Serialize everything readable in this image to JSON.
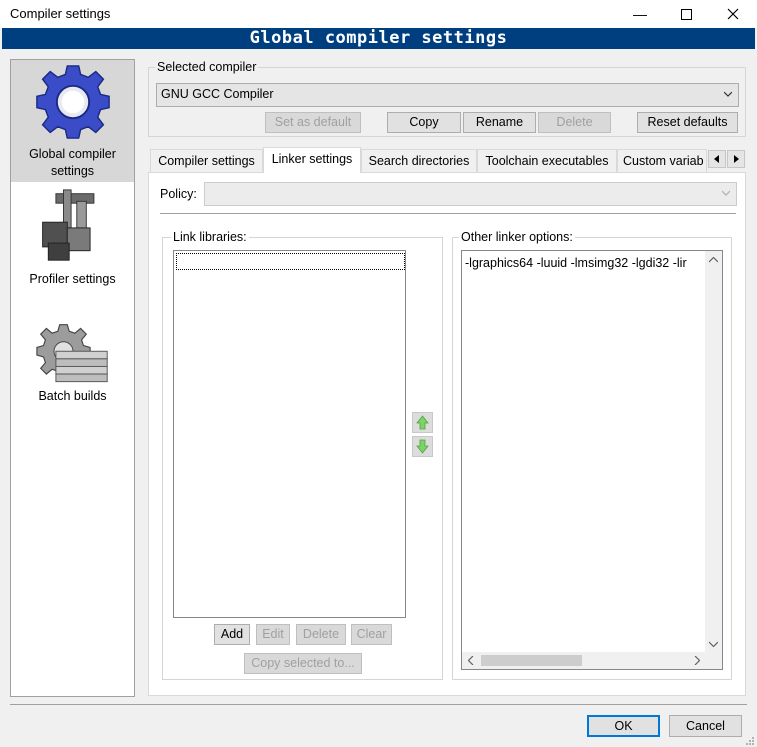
{
  "window": {
    "title": "Compiler settings",
    "banner": "Global compiler settings"
  },
  "sidebar": {
    "items": [
      {
        "label_line1": "Global compiler",
        "label_line2": "settings",
        "icon": "gear-icon",
        "selected": true
      },
      {
        "label": "Profiler settings",
        "icon": "profiler-icon",
        "selected": false
      },
      {
        "label": "Batch builds",
        "icon": "batch-builds-icon",
        "selected": false
      }
    ]
  },
  "compiler": {
    "group_label": "Selected compiler",
    "selected": "GNU GCC Compiler",
    "buttons": {
      "set_default": "Set as default",
      "copy": "Copy",
      "rename": "Rename",
      "delete": "Delete",
      "reset": "Reset defaults"
    }
  },
  "tabs": [
    {
      "label": "Compiler settings",
      "active": false
    },
    {
      "label": "Linker settings",
      "active": true
    },
    {
      "label": "Search directories",
      "active": false
    },
    {
      "label": "Toolchain executables",
      "active": false
    },
    {
      "label": "Custom variab",
      "active": false
    }
  ],
  "linker": {
    "policy_label": "Policy:",
    "policy_value": "",
    "libraries": {
      "group_label": "Link libraries:",
      "buttons": {
        "add": "Add",
        "edit": "Edit",
        "delete": "Delete",
        "clear": "Clear",
        "copy_selected": "Copy selected to..."
      }
    },
    "other": {
      "group_label": "Other linker options:",
      "text": "-lgraphics64 -luuid -lmsimg32 -lgdi32 -lir"
    }
  },
  "dialog_buttons": {
    "ok": "OK",
    "cancel": "Cancel"
  },
  "colors": {
    "banner_bg": "#003f7f",
    "banner_fg": "#ffffff",
    "selected_item_bg": "#d7d7d7",
    "arrow_green": "#7ed26a"
  }
}
